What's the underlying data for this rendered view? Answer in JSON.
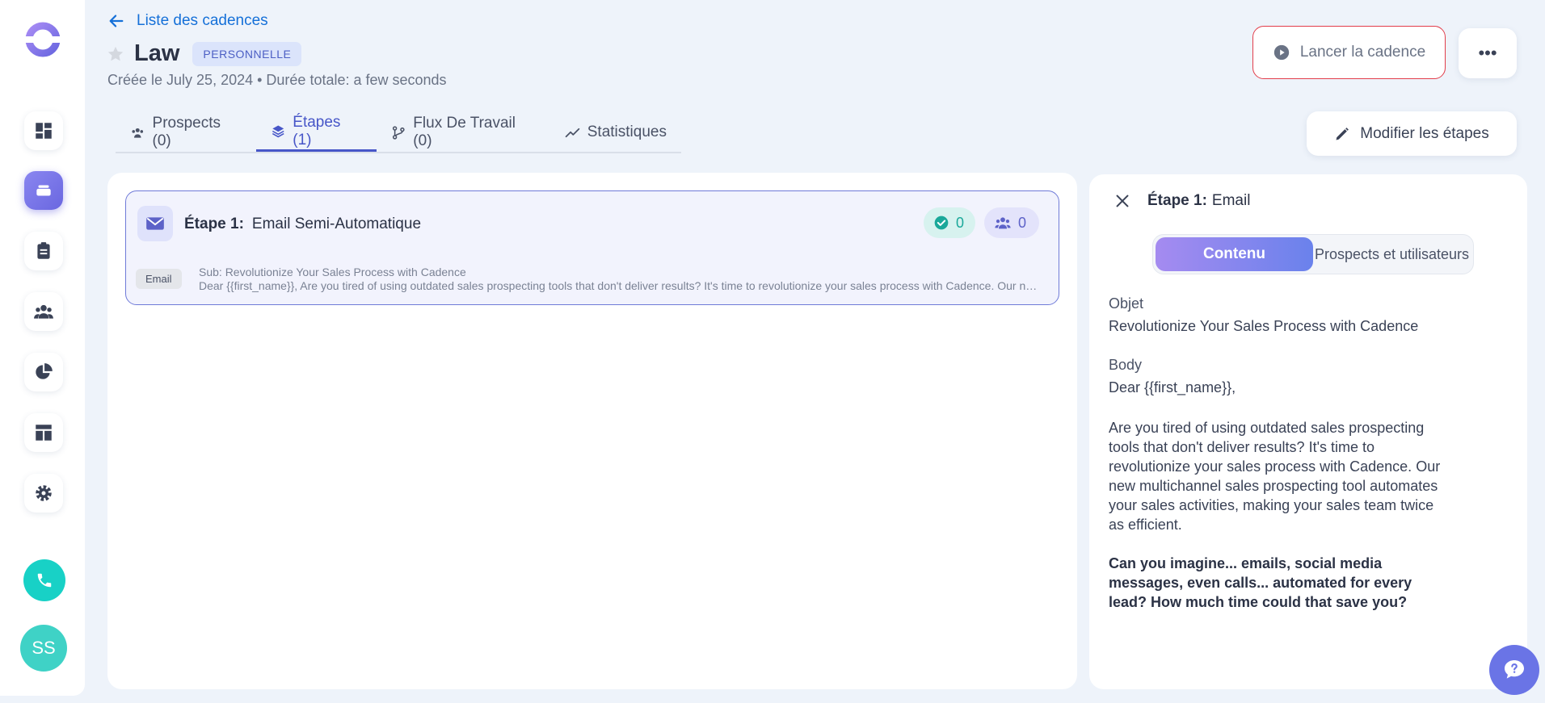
{
  "header": {
    "back_label": "Liste des cadences",
    "title": "Law",
    "badge": "PERSONNELLE",
    "subtitle": "Créée le July 25, 2024 • Durée totale: a few seconds",
    "launch_label": "Lancer la cadence",
    "more_label": "•••"
  },
  "tabs": [
    {
      "label": "Prospects (0)",
      "icon": "users-icon"
    },
    {
      "label": "Étapes (1)",
      "icon": "layers-icon"
    },
    {
      "label": "Flux De Travail (0)",
      "icon": "workflow-icon"
    },
    {
      "label": "Statistiques",
      "icon": "chart-line-icon"
    }
  ],
  "edit_steps_label": "Modifier les étapes",
  "step": {
    "number_label": "Étape 1:",
    "name": "Email Semi-Automatique",
    "done_count": "0",
    "people_count": "0",
    "chip": "Email",
    "subject_line": "Sub: Revolutionize Your Sales Process with Cadence",
    "body_preview": "Dear {{first_name}},   Are you tired of using outdated sales prospecting tools that don't deliver results? It's time to revolutionize your sales process with Cadence. Our new multichannel sales prospecting tool"
  },
  "detail": {
    "title_bold": "Étape 1:",
    "title_rest": "Email",
    "seg_content": "Contenu",
    "seg_prospects": "Prospects et utilisateurs",
    "object_label": "Objet",
    "object_value": "Revolutionize Your Sales Process with Cadence",
    "body_label": "Body",
    "greeting": "Dear {{first_name}},",
    "paragraph1": "Are you tired of using outdated sales prospecting tools that don't deliver results? It's time to revolutionize your sales process with Cadence. Our new multichannel sales prospecting tool automates your sales activities, making your sales team twice as efficient.",
    "paragraph2": "Can you imagine... emails, social media messages, even calls... automated for every lead? How much time could that save you?"
  },
  "user": {
    "initials": "SS"
  },
  "colors": {
    "accent": "#4756c8",
    "teal": "#18d1c6",
    "danger_outline": "#e23d4a"
  }
}
